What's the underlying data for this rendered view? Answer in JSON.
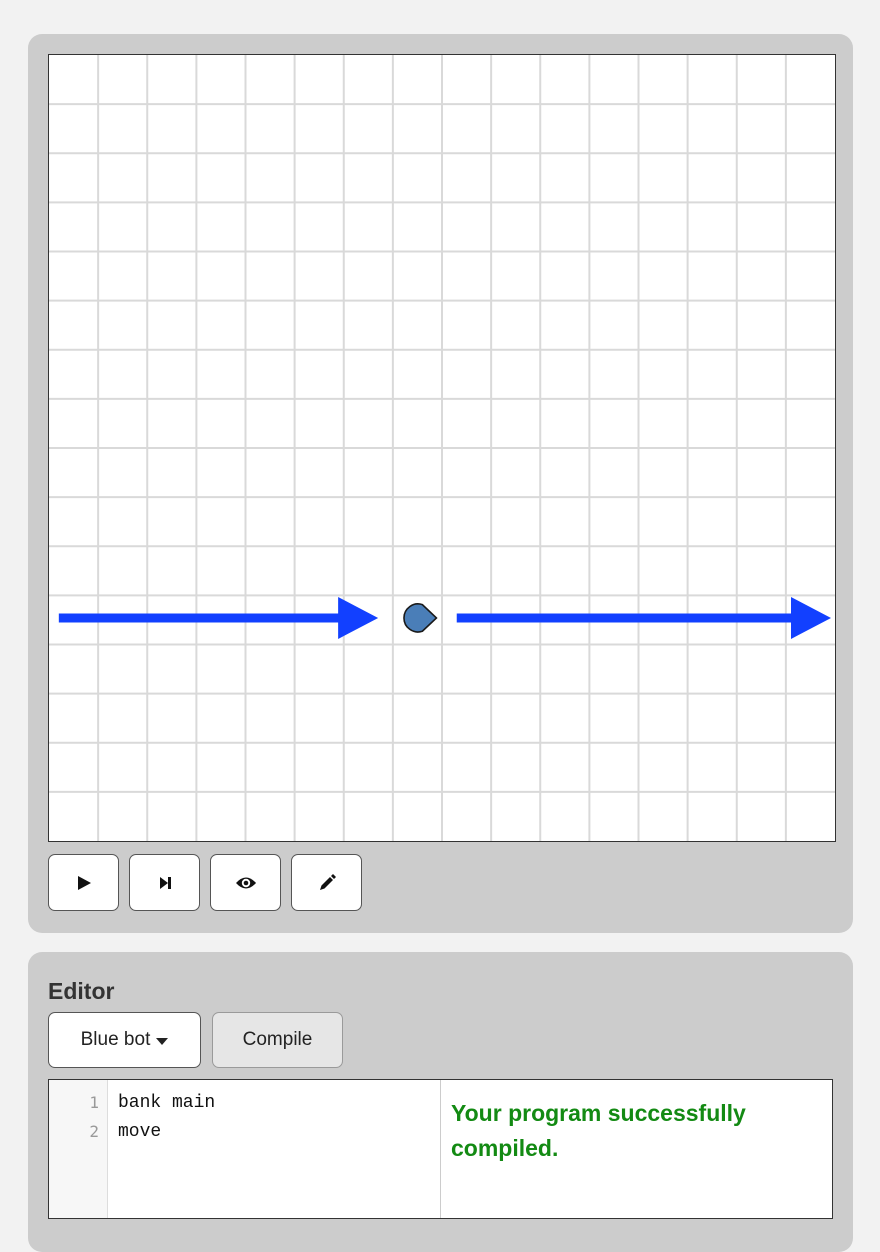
{
  "board": {
    "grid_columns": 16,
    "grid_rows": 16,
    "bot": {
      "name": "blue-bot",
      "color": "#4a7eb8",
      "column": 7,
      "row": 11,
      "facing": "right"
    },
    "arrow_color": "#1240ff"
  },
  "controls": [
    {
      "name": "play-button",
      "icon": "play-icon"
    },
    {
      "name": "step-button",
      "icon": "step-icon"
    },
    {
      "name": "watch-button",
      "icon": "eye-icon"
    },
    {
      "name": "edit-button",
      "icon": "pencil-icon"
    }
  ],
  "editor": {
    "title": "Editor",
    "bot_selector": "Blue bot",
    "compile_label": "Compile",
    "lines": [
      {
        "number": "1",
        "text": "bank main"
      },
      {
        "number": "2",
        "text": "move"
      }
    ],
    "status": "Your program successfully compiled.",
    "status_color": "#138a13"
  }
}
